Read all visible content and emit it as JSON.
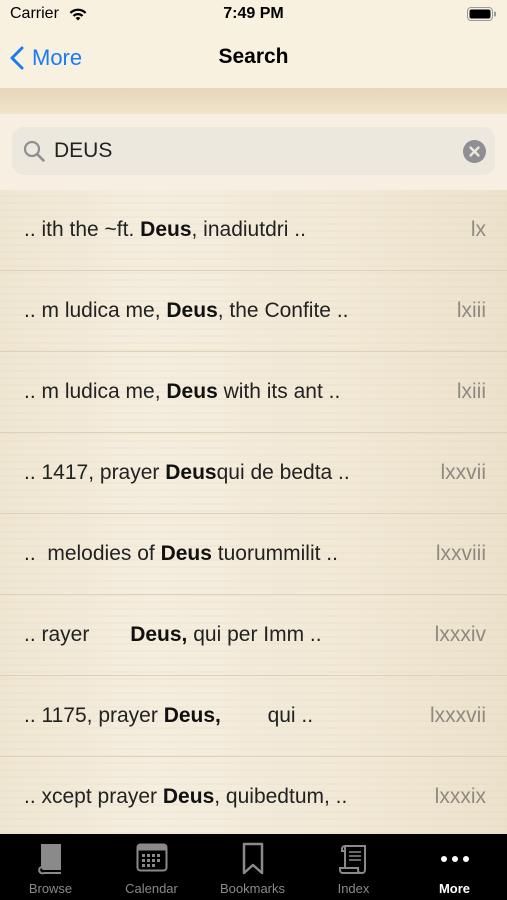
{
  "status": {
    "carrier": "Carrier",
    "time": "7:49 PM"
  },
  "nav": {
    "back_label": "More",
    "title": "Search"
  },
  "search": {
    "value": "DEUS"
  },
  "results": [
    {
      "pre": ".. ith the ~ft. ",
      "term": "Deus",
      "post": ", inadiutdri ..",
      "page": "lx"
    },
    {
      "pre": ".. m ludica me, ",
      "term": "Deus",
      "post": ", the Confite ..",
      "page": "lxiii"
    },
    {
      "pre": ".. m ludica me, ",
      "term": "Deus",
      "post": " with its ant ..",
      "page": "lxiii"
    },
    {
      "pre": ".. 1417, prayer ",
      "term": "Deus",
      "post": "qui de bedta ..",
      "page": "lxxvii"
    },
    {
      "pre": "..  melodies of ",
      "term": "Deus",
      "post": " tuorummilit ..",
      "page": "lxxviii"
    },
    {
      "pre": ".. rayer       ",
      "term": "Deus,",
      "post": " qui per Imm ..",
      "page": "lxxxiv"
    },
    {
      "pre": ".. 1175, prayer ",
      "term": "Deus,",
      "post": "        qui ..",
      "page": "lxxxvii"
    },
    {
      "pre": ".. xcept prayer ",
      "term": "Deus",
      "post": ", quibedtum, ..",
      "page": "lxxxix"
    }
  ],
  "tabs": [
    {
      "label": "Browse",
      "icon": "book-icon"
    },
    {
      "label": "Calendar",
      "icon": "calendar-icon"
    },
    {
      "label": "Bookmarks",
      "icon": "bookmark-icon"
    },
    {
      "label": "Index",
      "icon": "scroll-icon"
    },
    {
      "label": "More",
      "icon": "more-icon"
    }
  ],
  "colors": {
    "accent": "#1a7cf5",
    "tab_bar": "#000000",
    "tab_active": "#ffffff",
    "tab_inactive": "#8a8a8a"
  }
}
